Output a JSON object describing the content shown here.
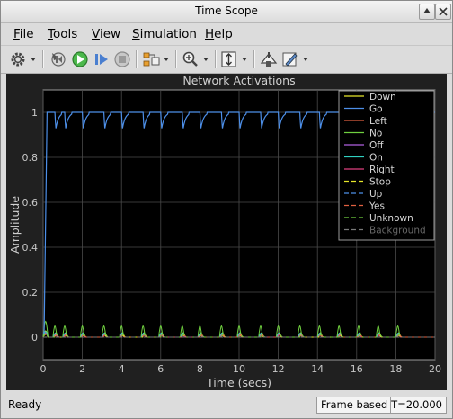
{
  "window": {
    "title": "Time Scope"
  },
  "menu": [
    {
      "label": "File",
      "u": "F",
      "rest": "ile"
    },
    {
      "label": "Tools",
      "u": "T",
      "rest": "ools"
    },
    {
      "label": "View",
      "u": "V",
      "rest": "iew"
    },
    {
      "label": "Simulation",
      "u": "S",
      "rest": "imulation"
    },
    {
      "label": "Help",
      "u": "H",
      "rest": "elp"
    }
  ],
  "toolbar": {
    "icons": [
      "settings-icon",
      "step-back-icon",
      "run-icon",
      "step-forward-icon",
      "stop-icon",
      "signal-select-icon",
      "zoom-in-icon",
      "autoscale-icon",
      "highlight-block-icon",
      "style-icon"
    ]
  },
  "status": {
    "state": "Ready",
    "mode": "Frame based",
    "time": "T=20.000"
  },
  "colors": {
    "plot_bg": "#000000",
    "frame_bg": "#202020",
    "grid": "#4a4a4a",
    "axis_text": "#c8c8c8",
    "go": "#4d8fe8",
    "no": "#6fcf3f",
    "down": "#e6e62a",
    "left": "#e06040",
    "off": "#b060e0",
    "on": "#30d0c0",
    "right": "#e04080"
  },
  "chart_data": {
    "type": "line",
    "title": "Network Activations",
    "xlabel": "Time (secs)",
    "ylabel": "Amplitude",
    "xlim": [
      0,
      20
    ],
    "ylim": [
      -0.1,
      1.1
    ],
    "xticks": [
      "0",
      "2",
      "4",
      "6",
      "8",
      "10",
      "12",
      "14",
      "16",
      "18",
      "20"
    ],
    "yticks": [
      "0",
      "0.2",
      "0.4",
      "0.6",
      "0.8",
      "1"
    ],
    "grid": true,
    "legend_position": "top-right",
    "dip_times": [
      0.6,
      1.1,
      2.0,
      3.1,
      4.0,
      5.1,
      6.0,
      7.1,
      8.0,
      9.1,
      10.0,
      11.1,
      12.0,
      13.1,
      14.1,
      15.1,
      16.1,
      17.1,
      18.1
    ],
    "series": [
      {
        "name": "Down",
        "color": "#e6e62a",
        "style": "solid"
      },
      {
        "name": "Go",
        "color": "#4d8fe8",
        "style": "solid",
        "start_time": 0.2,
        "high": 1.0,
        "dip_low": 0.9
      },
      {
        "name": "Left",
        "color": "#e06040",
        "style": "solid"
      },
      {
        "name": "No",
        "color": "#6fcf3f",
        "style": "solid",
        "peak": 0.05
      },
      {
        "name": "Off",
        "color": "#b060e0",
        "style": "solid"
      },
      {
        "name": "On",
        "color": "#30d0c0",
        "style": "solid"
      },
      {
        "name": "Right",
        "color": "#e04080",
        "style": "solid"
      },
      {
        "name": "Stop",
        "color": "#e6e62a",
        "style": "dashed"
      },
      {
        "name": "Up",
        "color": "#4d8fe8",
        "style": "dashed"
      },
      {
        "name": "Yes",
        "color": "#e06040",
        "style": "dashed"
      },
      {
        "name": "Unknown",
        "color": "#6fcf3f",
        "style": "dashed"
      },
      {
        "name": "Background",
        "color": "#7a7a7a",
        "style": "dashed"
      }
    ]
  }
}
